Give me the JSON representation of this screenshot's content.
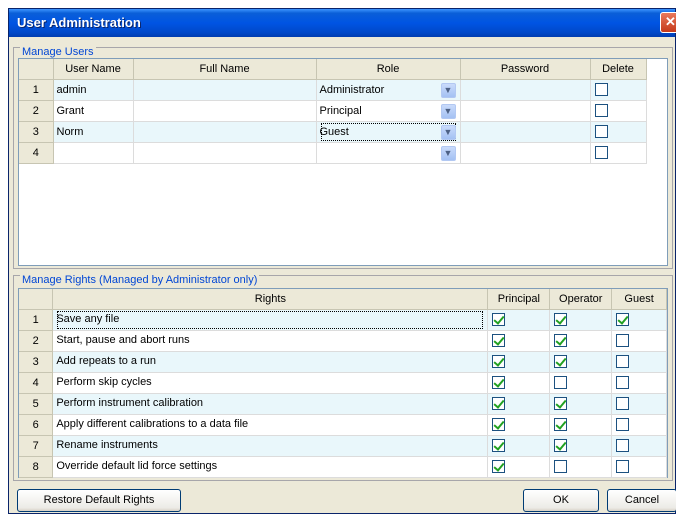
{
  "window": {
    "title": "User Administration",
    "close_glyph": "✕"
  },
  "users": {
    "group_label": "Manage Users",
    "columns": [
      "User Name",
      "Full Name",
      "Role",
      "Password",
      "Delete"
    ],
    "rows": [
      {
        "num": "1",
        "user_name": "admin",
        "full_name": "",
        "role": "Administrator",
        "password": "",
        "delete": false
      },
      {
        "num": "2",
        "user_name": "Grant",
        "full_name": "",
        "role": "Principal",
        "password": "",
        "delete": false
      },
      {
        "num": "3",
        "user_name": "Norm",
        "full_name": "",
        "role": "Guest",
        "password": "",
        "delete": false
      },
      {
        "num": "4",
        "user_name": "",
        "full_name": "",
        "role": "",
        "password": "",
        "delete": false
      }
    ]
  },
  "rights": {
    "group_label": "Manage Rights (Managed by Administrator only)",
    "columns": [
      "Rights",
      "Principal",
      "Operator",
      "Guest"
    ],
    "rows": [
      {
        "num": "1",
        "right": "Save any file",
        "principal": true,
        "operator": true,
        "guest": true
      },
      {
        "num": "2",
        "right": "Start, pause and abort runs",
        "principal": true,
        "operator": true,
        "guest": false
      },
      {
        "num": "3",
        "right": "Add repeats to a run",
        "principal": true,
        "operator": true,
        "guest": false
      },
      {
        "num": "4",
        "right": "Perform skip cycles",
        "principal": true,
        "operator": false,
        "guest": false
      },
      {
        "num": "5",
        "right": "Perform instrument calibration",
        "principal": true,
        "operator": true,
        "guest": false
      },
      {
        "num": "6",
        "right": "Apply different calibrations to a data file",
        "principal": true,
        "operator": true,
        "guest": false
      },
      {
        "num": "7",
        "right": "Rename instruments",
        "principal": true,
        "operator": true,
        "guest": false
      },
      {
        "num": "8",
        "right": "Override default lid force settings",
        "principal": true,
        "operator": false,
        "guest": false
      }
    ]
  },
  "buttons": {
    "restore": "Restore Default Rights",
    "ok": "OK",
    "cancel": "Cancel"
  },
  "icons": {
    "dropdown": "chevron-down-icon",
    "check": "checkmark-icon"
  },
  "colors": {
    "titlebar": "#0054e3",
    "group_label": "#0046d5",
    "alt_row": "#e9f7fb",
    "check": "#21a121"
  }
}
